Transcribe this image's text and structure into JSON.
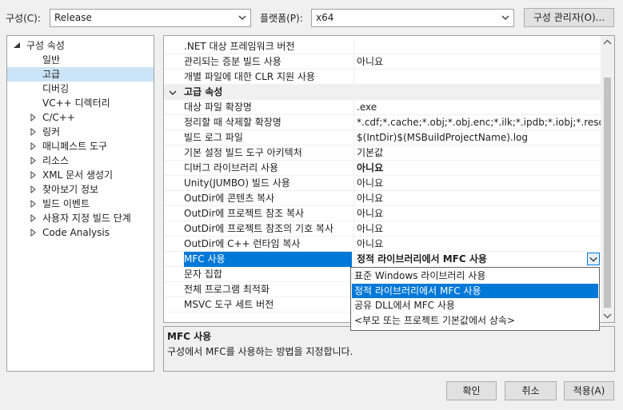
{
  "toolbar": {
    "config_label": "구성(C):",
    "config_value": "Release",
    "platform_label": "플랫폼(P):",
    "platform_value": "x64",
    "config_manager_label": "구성 관리자(O)..."
  },
  "tree": {
    "root": "구성 속성",
    "items": [
      {
        "label": "일반",
        "expandable": false
      },
      {
        "label": "고급",
        "expandable": false,
        "selected": true
      },
      {
        "label": "디버깅",
        "expandable": false
      },
      {
        "label": "VC++ 디렉터리",
        "expandable": false
      },
      {
        "label": "C/C++",
        "expandable": true
      },
      {
        "label": "링커",
        "expandable": true
      },
      {
        "label": "매니페스트 도구",
        "expandable": true
      },
      {
        "label": "리소스",
        "expandable": true
      },
      {
        "label": "XML 문서 생성기",
        "expandable": true
      },
      {
        "label": "찾아보기 정보",
        "expandable": true
      },
      {
        "label": "빌드 이벤트",
        "expandable": true
      },
      {
        "label": "사용자 지정 빌드 단계",
        "expandable": true
      },
      {
        "label": "Code Analysis",
        "expandable": true
      }
    ]
  },
  "grid": {
    "top_rows": [
      {
        "name": ".NET 대상 프레임워크 버전",
        "value": ""
      },
      {
        "name": "관리되는 증분 빌드 사용",
        "value": "아니요"
      },
      {
        "name": "개별 파일에 대한 CLR 지원 사용",
        "value": ""
      }
    ],
    "category": "고급 속성",
    "rows": [
      {
        "name": "대상 파일 확장명",
        "value": ".exe"
      },
      {
        "name": "정리할 때 삭제할 확장명",
        "value": "*.cdf;*.cache;*.obj;*.obj.enc;*.ilk;*.ipdb;*.iobj;*.resources;*.tlb"
      },
      {
        "name": "빌드 로그 파일",
        "value": "$(IntDir)$(MSBuildProjectName).log"
      },
      {
        "name": "기본 설정 빌드 도구 아키텍처",
        "value": "기본값"
      },
      {
        "name": "디버그 라이브러리 사용",
        "value": "아니요",
        "bold": true
      },
      {
        "name": "Unity(JUMBO) 빌드 사용",
        "value": "아니요"
      },
      {
        "name": "OutDir에 콘텐츠 복사",
        "value": "아니요"
      },
      {
        "name": "OutDir에 프로젝트 참조 복사",
        "value": "아니요"
      },
      {
        "name": "OutDir에 프로젝트 참조의 기호 복사",
        "value": "아니요"
      },
      {
        "name": "OutDir에 C++ 런타임 복사",
        "value": "아니요"
      },
      {
        "name": "MFC 사용",
        "value": "정적 라이브러리에서 MFC 사용",
        "bold": true,
        "selected": true
      },
      {
        "name": "문자 집합",
        "value": ""
      },
      {
        "name": "전체 프로그램 최적화",
        "value": ""
      },
      {
        "name": "MSVC 도구 세트 버전",
        "value": ""
      }
    ]
  },
  "dropdown": {
    "options": [
      "표준 Windows 라이브러리 사용",
      "정적 라이브러리에서 MFC 사용",
      "공유 DLL에서 MFC 사용",
      "<부모 또는 프로젝트 기본값에서 상속>"
    ],
    "selected_index": 1
  },
  "description": {
    "title": "MFC 사용",
    "text": "구성에서 MFC를 사용하는 방법을 지정합니다."
  },
  "buttons": {
    "ok": "확인",
    "cancel": "취소",
    "apply": "적용(A)"
  },
  "colors": {
    "selection": "#0078d7",
    "tree_selection": "#cce4f7"
  }
}
